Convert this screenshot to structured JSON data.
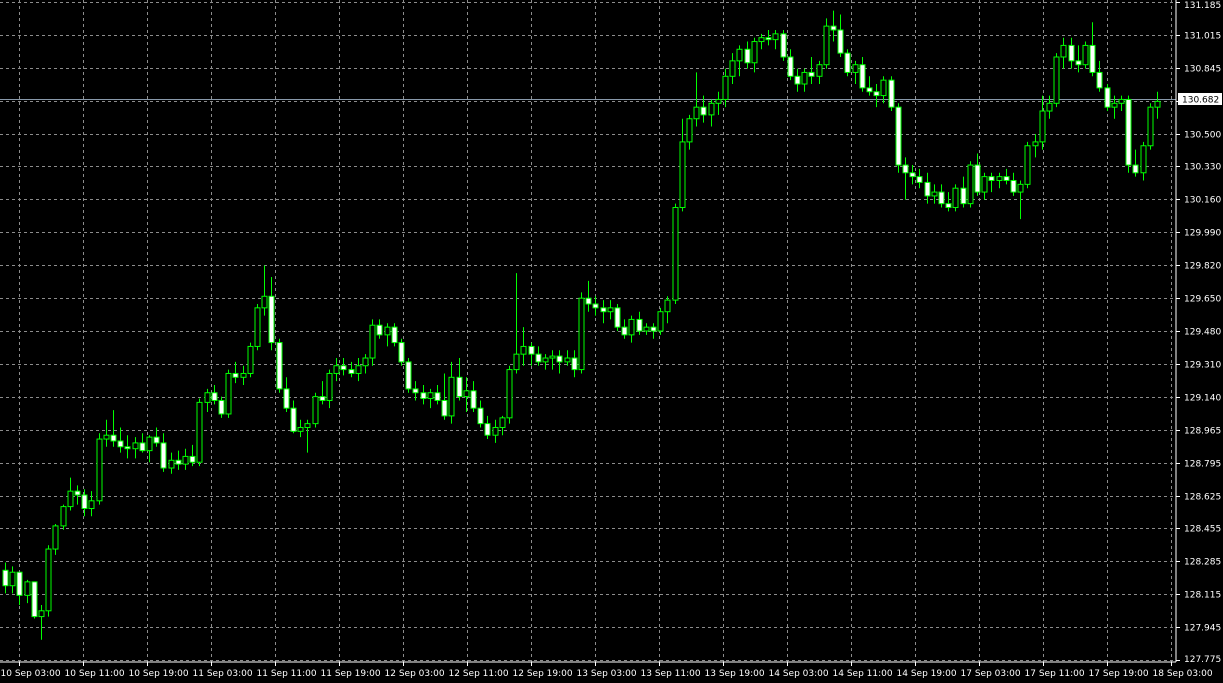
{
  "chart_data": {
    "type": "candlestick",
    "title": "",
    "xlabel": "",
    "ylabel": "",
    "ylim": [
      127.775,
      131.185
    ],
    "grid": true,
    "y_ticks": [
      "131.185",
      "131.015",
      "130.845",
      "130.670",
      "130.500",
      "130.330",
      "130.160",
      "129.990",
      "129.820",
      "129.650",
      "129.480",
      "129.310",
      "129.140",
      "128.965",
      "128.795",
      "128.625",
      "128.455",
      "128.285",
      "128.115",
      "127.945",
      "127.775"
    ],
    "x_ticks": [
      "10 Sep 03:00",
      "10 Sep 11:00",
      "10 Sep 19:00",
      "11 Sep 03:00",
      "11 Sep 11:00",
      "11 Sep 19:00",
      "12 Sep 03:00",
      "12 Sep 11:00",
      "12 Sep 19:00",
      "13 Sep 03:00",
      "13 Sep 11:00",
      "13 Sep 19:00",
      "14 Sep 03:00",
      "14 Sep 11:00",
      "14 Sep 19:00",
      "17 Sep 03:00",
      "17 Sep 11:00",
      "17 Sep 19:00",
      "18 Sep 03:00"
    ],
    "current_price": 130.682,
    "current_price_label": "130.682",
    "colors": {
      "background": "#000000",
      "grid": "#8c8c8c",
      "candle": "#00ff00",
      "bull_fill": "#000000",
      "bear_fill": "#ffffff",
      "axis_text": "#ffffff",
      "price_line": "#8899aa"
    },
    "candles": [
      {
        "o": 128.24,
        "h": 128.28,
        "l": 128.12,
        "c": 128.16
      },
      {
        "o": 128.16,
        "h": 128.26,
        "l": 128.12,
        "c": 128.23
      },
      {
        "o": 128.23,
        "h": 128.23,
        "l": 128.06,
        "c": 128.11
      },
      {
        "o": 128.11,
        "h": 128.19,
        "l": 128.07,
        "c": 128.18
      },
      {
        "o": 128.18,
        "h": 128.18,
        "l": 127.99,
        "c": 128.0
      },
      {
        "o": 128.0,
        "h": 128.06,
        "l": 127.88,
        "c": 128.03
      },
      {
        "o": 128.03,
        "h": 128.37,
        "l": 128.0,
        "c": 128.35
      },
      {
        "o": 128.35,
        "h": 128.48,
        "l": 128.32,
        "c": 128.47
      },
      {
        "o": 128.47,
        "h": 128.58,
        "l": 128.45,
        "c": 128.57
      },
      {
        "o": 128.57,
        "h": 128.72,
        "l": 128.55,
        "c": 128.65
      },
      {
        "o": 128.65,
        "h": 128.68,
        "l": 128.58,
        "c": 128.63
      },
      {
        "o": 128.63,
        "h": 128.66,
        "l": 128.52,
        "c": 128.56
      },
      {
        "o": 128.56,
        "h": 128.65,
        "l": 128.52,
        "c": 128.6
      },
      {
        "o": 128.6,
        "h": 128.95,
        "l": 128.58,
        "c": 128.92
      },
      {
        "o": 128.92,
        "h": 129.02,
        "l": 128.88,
        "c": 128.94
      },
      {
        "o": 128.94,
        "h": 129.07,
        "l": 128.88,
        "c": 128.91
      },
      {
        "o": 128.91,
        "h": 128.98,
        "l": 128.85,
        "c": 128.88
      },
      {
        "o": 128.88,
        "h": 128.94,
        "l": 128.82,
        "c": 128.87
      },
      {
        "o": 128.87,
        "h": 128.93,
        "l": 128.82,
        "c": 128.9
      },
      {
        "o": 128.9,
        "h": 128.95,
        "l": 128.85,
        "c": 128.86
      },
      {
        "o": 128.86,
        "h": 128.94,
        "l": 128.8,
        "c": 128.93
      },
      {
        "o": 128.93,
        "h": 128.98,
        "l": 128.88,
        "c": 128.9
      },
      {
        "o": 128.9,
        "h": 128.95,
        "l": 128.75,
        "c": 128.77
      },
      {
        "o": 128.77,
        "h": 128.85,
        "l": 128.74,
        "c": 128.81
      },
      {
        "o": 128.81,
        "h": 128.86,
        "l": 128.76,
        "c": 128.79
      },
      {
        "o": 128.79,
        "h": 128.87,
        "l": 128.76,
        "c": 128.83
      },
      {
        "o": 128.83,
        "h": 128.89,
        "l": 128.78,
        "c": 128.8
      },
      {
        "o": 128.8,
        "h": 129.13,
        "l": 128.78,
        "c": 129.11
      },
      {
        "o": 129.11,
        "h": 129.18,
        "l": 129.06,
        "c": 129.16
      },
      {
        "o": 129.16,
        "h": 129.2,
        "l": 129.1,
        "c": 129.12
      },
      {
        "o": 129.12,
        "h": 129.14,
        "l": 129.03,
        "c": 129.05
      },
      {
        "o": 129.05,
        "h": 129.28,
        "l": 129.03,
        "c": 129.26
      },
      {
        "o": 129.26,
        "h": 129.32,
        "l": 129.21,
        "c": 129.24
      },
      {
        "o": 129.24,
        "h": 129.3,
        "l": 129.2,
        "c": 129.26
      },
      {
        "o": 129.26,
        "h": 129.42,
        "l": 129.24,
        "c": 129.4
      },
      {
        "o": 129.4,
        "h": 129.62,
        "l": 129.38,
        "c": 129.6
      },
      {
        "o": 129.6,
        "h": 129.82,
        "l": 129.56,
        "c": 129.66
      },
      {
        "o": 129.66,
        "h": 129.76,
        "l": 129.38,
        "c": 129.42
      },
      {
        "o": 129.42,
        "h": 129.44,
        "l": 129.16,
        "c": 129.18
      },
      {
        "o": 129.18,
        "h": 129.24,
        "l": 129.06,
        "c": 129.08
      },
      {
        "o": 129.08,
        "h": 129.12,
        "l": 128.95,
        "c": 128.96
      },
      {
        "o": 128.96,
        "h": 129.02,
        "l": 128.93,
        "c": 128.98
      },
      {
        "o": 128.98,
        "h": 129.02,
        "l": 128.85,
        "c": 129.0
      },
      {
        "o": 129.0,
        "h": 129.16,
        "l": 128.98,
        "c": 129.14
      },
      {
        "o": 129.14,
        "h": 129.22,
        "l": 129.1,
        "c": 129.12
      },
      {
        "o": 129.12,
        "h": 129.28,
        "l": 129.08,
        "c": 129.26
      },
      {
        "o": 129.26,
        "h": 129.34,
        "l": 129.22,
        "c": 129.3
      },
      {
        "o": 129.3,
        "h": 129.34,
        "l": 129.25,
        "c": 129.28
      },
      {
        "o": 129.28,
        "h": 129.32,
        "l": 129.24,
        "c": 129.26
      },
      {
        "o": 129.26,
        "h": 129.34,
        "l": 129.22,
        "c": 129.3
      },
      {
        "o": 129.3,
        "h": 129.36,
        "l": 129.26,
        "c": 129.34
      },
      {
        "o": 129.34,
        "h": 129.54,
        "l": 129.3,
        "c": 129.51
      },
      {
        "o": 129.51,
        "h": 129.54,
        "l": 129.44,
        "c": 129.46
      },
      {
        "o": 129.46,
        "h": 129.52,
        "l": 129.4,
        "c": 129.5
      },
      {
        "o": 129.5,
        "h": 129.52,
        "l": 129.4,
        "c": 129.42
      },
      {
        "o": 129.42,
        "h": 129.44,
        "l": 129.3,
        "c": 129.32
      },
      {
        "o": 129.32,
        "h": 129.34,
        "l": 129.16,
        "c": 129.18
      },
      {
        "o": 129.18,
        "h": 129.22,
        "l": 129.12,
        "c": 129.16
      },
      {
        "o": 129.16,
        "h": 129.2,
        "l": 129.1,
        "c": 129.13
      },
      {
        "o": 129.13,
        "h": 129.18,
        "l": 129.08,
        "c": 129.16
      },
      {
        "o": 129.16,
        "h": 129.2,
        "l": 129.1,
        "c": 129.12
      },
      {
        "o": 129.12,
        "h": 129.26,
        "l": 129.02,
        "c": 129.04
      },
      {
        "o": 129.04,
        "h": 129.32,
        "l": 129.0,
        "c": 129.24
      },
      {
        "o": 129.24,
        "h": 129.34,
        "l": 129.12,
        "c": 129.14
      },
      {
        "o": 129.14,
        "h": 129.24,
        "l": 129.06,
        "c": 129.17
      },
      {
        "o": 129.17,
        "h": 129.22,
        "l": 129.06,
        "c": 129.08
      },
      {
        "o": 129.08,
        "h": 129.12,
        "l": 128.98,
        "c": 129.0
      },
      {
        "o": 129.0,
        "h": 129.04,
        "l": 128.92,
        "c": 128.94
      },
      {
        "o": 128.94,
        "h": 129.02,
        "l": 128.9,
        "c": 128.98
      },
      {
        "o": 128.98,
        "h": 129.04,
        "l": 128.94,
        "c": 129.03
      },
      {
        "o": 129.03,
        "h": 129.3,
        "l": 129.0,
        "c": 129.28
      },
      {
        "o": 129.28,
        "h": 129.78,
        "l": 129.26,
        "c": 129.36
      },
      {
        "o": 129.36,
        "h": 129.5,
        "l": 129.3,
        "c": 129.4
      },
      {
        "o": 129.4,
        "h": 129.42,
        "l": 129.3,
        "c": 129.36
      },
      {
        "o": 129.36,
        "h": 129.4,
        "l": 129.3,
        "c": 129.32
      },
      {
        "o": 129.32,
        "h": 129.36,
        "l": 129.28,
        "c": 129.34
      },
      {
        "o": 129.34,
        "h": 129.38,
        "l": 129.28,
        "c": 129.35
      },
      {
        "o": 129.35,
        "h": 129.38,
        "l": 129.26,
        "c": 129.32
      },
      {
        "o": 129.32,
        "h": 129.38,
        "l": 129.3,
        "c": 129.34
      },
      {
        "o": 129.34,
        "h": 129.38,
        "l": 129.24,
        "c": 129.28
      },
      {
        "o": 129.28,
        "h": 129.68,
        "l": 129.26,
        "c": 129.65
      },
      {
        "o": 129.65,
        "h": 129.74,
        "l": 129.58,
        "c": 129.62
      },
      {
        "o": 129.62,
        "h": 129.66,
        "l": 129.56,
        "c": 129.6
      },
      {
        "o": 129.6,
        "h": 129.64,
        "l": 129.52,
        "c": 129.58
      },
      {
        "o": 129.58,
        "h": 129.64,
        "l": 129.54,
        "c": 129.6
      },
      {
        "o": 129.6,
        "h": 129.62,
        "l": 129.48,
        "c": 129.5
      },
      {
        "o": 129.5,
        "h": 129.54,
        "l": 129.44,
        "c": 129.46
      },
      {
        "o": 129.46,
        "h": 129.56,
        "l": 129.42,
        "c": 129.54
      },
      {
        "o": 129.54,
        "h": 129.58,
        "l": 129.46,
        "c": 129.48
      },
      {
        "o": 129.48,
        "h": 129.52,
        "l": 129.46,
        "c": 129.5
      },
      {
        "o": 129.5,
        "h": 129.52,
        "l": 129.44,
        "c": 129.48
      },
      {
        "o": 129.48,
        "h": 129.6,
        "l": 129.46,
        "c": 129.58
      },
      {
        "o": 129.58,
        "h": 129.66,
        "l": 129.52,
        "c": 129.64
      },
      {
        "o": 129.64,
        "h": 130.14,
        "l": 129.62,
        "c": 130.12
      },
      {
        "o": 130.12,
        "h": 130.58,
        "l": 130.1,
        "c": 130.46
      },
      {
        "o": 130.46,
        "h": 130.6,
        "l": 130.42,
        "c": 130.58
      },
      {
        "o": 130.58,
        "h": 130.82,
        "l": 130.54,
        "c": 130.64
      },
      {
        "o": 130.64,
        "h": 130.7,
        "l": 130.56,
        "c": 130.6
      },
      {
        "o": 130.6,
        "h": 130.68,
        "l": 130.54,
        "c": 130.66
      },
      {
        "o": 130.66,
        "h": 130.72,
        "l": 130.6,
        "c": 130.68
      },
      {
        "o": 130.68,
        "h": 130.84,
        "l": 130.64,
        "c": 130.8
      },
      {
        "o": 130.8,
        "h": 130.92,
        "l": 130.76,
        "c": 130.88
      },
      {
        "o": 130.88,
        "h": 130.96,
        "l": 130.8,
        "c": 130.94
      },
      {
        "o": 130.94,
        "h": 130.98,
        "l": 130.84,
        "c": 130.87
      },
      {
        "o": 130.87,
        "h": 131.0,
        "l": 130.82,
        "c": 130.98
      },
      {
        "o": 130.98,
        "h": 131.02,
        "l": 130.94,
        "c": 131.0
      },
      {
        "o": 131.0,
        "h": 131.04,
        "l": 130.96,
        "c": 130.99
      },
      {
        "o": 130.99,
        "h": 131.04,
        "l": 130.94,
        "c": 131.02
      },
      {
        "o": 131.02,
        "h": 131.04,
        "l": 130.88,
        "c": 130.9
      },
      {
        "o": 130.9,
        "h": 130.94,
        "l": 130.78,
        "c": 130.8
      },
      {
        "o": 130.8,
        "h": 130.84,
        "l": 130.72,
        "c": 130.76
      },
      {
        "o": 130.76,
        "h": 130.84,
        "l": 130.72,
        "c": 130.82
      },
      {
        "o": 130.82,
        "h": 130.9,
        "l": 130.76,
        "c": 130.8
      },
      {
        "o": 130.8,
        "h": 130.88,
        "l": 130.76,
        "c": 130.86
      },
      {
        "o": 130.86,
        "h": 131.1,
        "l": 130.84,
        "c": 131.06
      },
      {
        "o": 131.06,
        "h": 131.14,
        "l": 130.98,
        "c": 131.04
      },
      {
        "o": 131.04,
        "h": 131.12,
        "l": 130.9,
        "c": 130.92
      },
      {
        "o": 130.92,
        "h": 130.94,
        "l": 130.8,
        "c": 130.82
      },
      {
        "o": 130.82,
        "h": 130.88,
        "l": 130.76,
        "c": 130.86
      },
      {
        "o": 130.86,
        "h": 130.9,
        "l": 130.72,
        "c": 130.74
      },
      {
        "o": 130.74,
        "h": 130.8,
        "l": 130.7,
        "c": 130.72
      },
      {
        "o": 130.72,
        "h": 130.76,
        "l": 130.64,
        "c": 130.7
      },
      {
        "o": 130.7,
        "h": 130.8,
        "l": 130.66,
        "c": 130.78
      },
      {
        "o": 130.78,
        "h": 130.8,
        "l": 130.62,
        "c": 130.64
      },
      {
        "o": 130.64,
        "h": 130.66,
        "l": 130.3,
        "c": 130.34
      },
      {
        "o": 130.34,
        "h": 130.38,
        "l": 130.16,
        "c": 130.3
      },
      {
        "o": 130.3,
        "h": 130.34,
        "l": 130.24,
        "c": 130.28
      },
      {
        "o": 130.28,
        "h": 130.32,
        "l": 130.22,
        "c": 130.25
      },
      {
        "o": 130.25,
        "h": 130.3,
        "l": 130.14,
        "c": 130.18
      },
      {
        "o": 130.18,
        "h": 130.24,
        "l": 130.14,
        "c": 130.2
      },
      {
        "o": 130.2,
        "h": 130.24,
        "l": 130.12,
        "c": 130.14
      },
      {
        "o": 130.14,
        "h": 130.2,
        "l": 130.1,
        "c": 130.12
      },
      {
        "o": 130.12,
        "h": 130.24,
        "l": 130.1,
        "c": 130.22
      },
      {
        "o": 130.22,
        "h": 130.28,
        "l": 130.12,
        "c": 130.14
      },
      {
        "o": 130.14,
        "h": 130.36,
        "l": 130.12,
        "c": 130.34
      },
      {
        "o": 130.34,
        "h": 130.4,
        "l": 130.18,
        "c": 130.2
      },
      {
        "o": 130.2,
        "h": 130.3,
        "l": 130.16,
        "c": 130.28
      },
      {
        "o": 130.28,
        "h": 130.3,
        "l": 130.2,
        "c": 130.26
      },
      {
        "o": 130.26,
        "h": 130.3,
        "l": 130.22,
        "c": 130.28
      },
      {
        "o": 130.28,
        "h": 130.32,
        "l": 130.24,
        "c": 130.26
      },
      {
        "o": 130.26,
        "h": 130.3,
        "l": 130.18,
        "c": 130.2
      },
      {
        "o": 130.2,
        "h": 130.26,
        "l": 130.06,
        "c": 130.24
      },
      {
        "o": 130.24,
        "h": 130.46,
        "l": 130.22,
        "c": 130.44
      },
      {
        "o": 130.44,
        "h": 130.5,
        "l": 130.38,
        "c": 130.46
      },
      {
        "o": 130.46,
        "h": 130.7,
        "l": 130.42,
        "c": 130.62
      },
      {
        "o": 130.62,
        "h": 130.7,
        "l": 130.58,
        "c": 130.66
      },
      {
        "o": 130.66,
        "h": 130.92,
        "l": 130.64,
        "c": 130.9
      },
      {
        "o": 130.9,
        "h": 131.0,
        "l": 130.84,
        "c": 130.96
      },
      {
        "o": 130.96,
        "h": 131.0,
        "l": 130.84,
        "c": 130.88
      },
      {
        "o": 130.88,
        "h": 130.96,
        "l": 130.82,
        "c": 130.86
      },
      {
        "o": 130.86,
        "h": 130.98,
        "l": 130.84,
        "c": 130.96
      },
      {
        "o": 130.96,
        "h": 131.08,
        "l": 130.8,
        "c": 130.82
      },
      {
        "o": 130.82,
        "h": 130.88,
        "l": 130.72,
        "c": 130.74
      },
      {
        "o": 130.74,
        "h": 130.76,
        "l": 130.62,
        "c": 130.64
      },
      {
        "o": 130.64,
        "h": 130.7,
        "l": 130.58,
        "c": 130.66
      },
      {
        "o": 130.66,
        "h": 130.7,
        "l": 130.62,
        "c": 130.68
      },
      {
        "o": 130.68,
        "h": 130.7,
        "l": 130.3,
        "c": 130.34
      },
      {
        "o": 130.34,
        "h": 130.42,
        "l": 130.28,
        "c": 130.3
      },
      {
        "o": 130.3,
        "h": 130.46,
        "l": 130.26,
        "c": 130.44
      },
      {
        "o": 130.44,
        "h": 130.66,
        "l": 130.42,
        "c": 130.64
      },
      {
        "o": 130.64,
        "h": 130.72,
        "l": 130.58,
        "c": 130.67
      }
    ]
  }
}
